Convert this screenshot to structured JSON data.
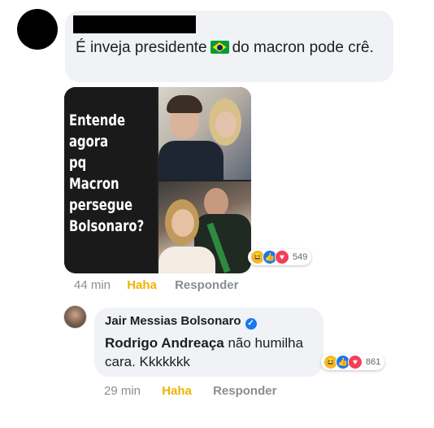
{
  "comment1": {
    "text_before_flag": "É inveja presidente",
    "text_after_flag": "do macron pode crê.",
    "meme": {
      "caption": "Entende\nagora\npq Macron\npersegue\nBolsonaro?"
    },
    "reactions_count": "549",
    "time": "44 min",
    "haha_label": "Haha",
    "reply_label": "Responder"
  },
  "comment2": {
    "author": "Jair Messias Bolsonaro",
    "mention": "Rodrigo Andreaça",
    "text": " não humilha cara. Kkkkkkk",
    "reactions_count": "861",
    "time": "29 min",
    "haha_label": "Haha",
    "reply_label": "Responder"
  },
  "icons": [
    "brazil-flag-icon",
    "haha-reaction-icon",
    "like-reaction-icon",
    "love-reaction-icon",
    "verified-badge-icon"
  ],
  "colors": {
    "bubble": "#f1f2f5",
    "haha": "#f0b300",
    "like": "#1877f2",
    "love": "#f33e58",
    "meta": "#8a8d91"
  }
}
